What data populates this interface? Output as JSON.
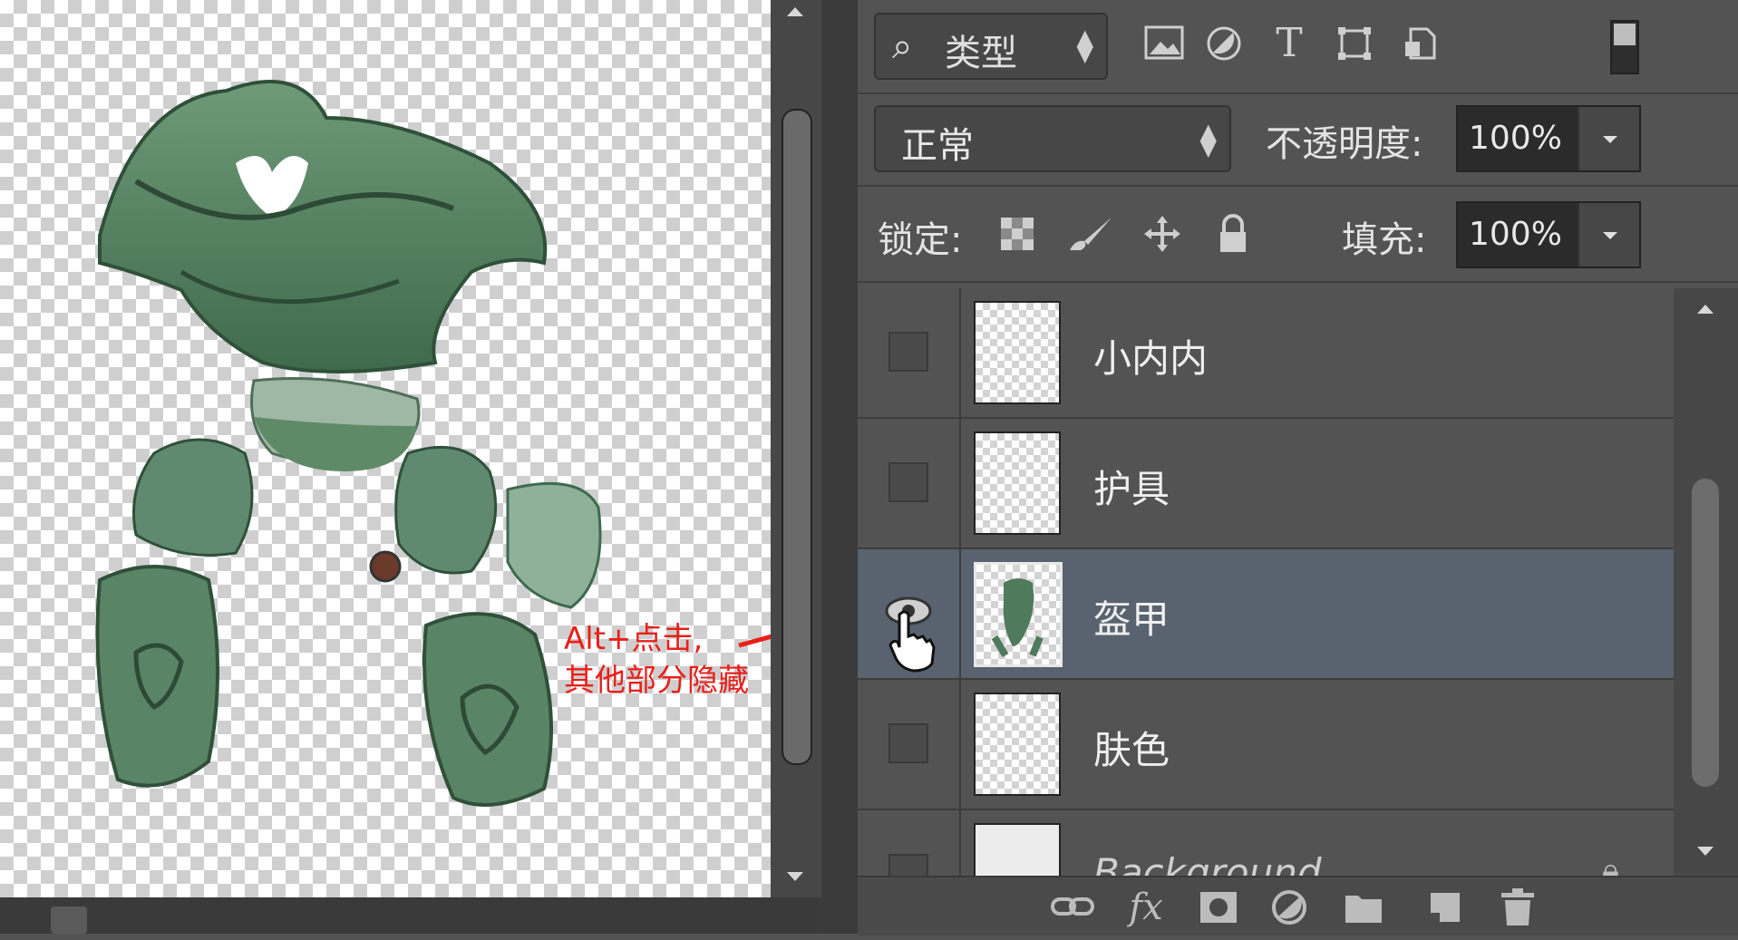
{
  "filter_bar": {
    "search_icon": "magnifier-icon",
    "filter_type_label": "类型",
    "icons": [
      "image-filter-icon",
      "adjustment-filter-icon",
      "text-filter-icon",
      "shape-filter-icon",
      "smart-object-filter-icon"
    ],
    "text_icon_glyph": "T"
  },
  "blend_row": {
    "blend_mode": "正常",
    "opacity_label": "不透明度:",
    "opacity_value": "100%"
  },
  "lock_row": {
    "lock_label": "锁定:",
    "fill_label": "填充:",
    "fill_value": "100%"
  },
  "layers": [
    {
      "name": "小内内",
      "visible": false,
      "selected": false
    },
    {
      "name": "护具",
      "visible": false,
      "selected": false
    },
    {
      "name": "盔甲",
      "visible": true,
      "selected": true
    },
    {
      "name": "肤色",
      "visible": false,
      "selected": false
    },
    {
      "name": "Background",
      "visible": false,
      "selected": false,
      "locked": true
    }
  ],
  "annotation": {
    "line1": "Alt+点击,",
    "line2": "其他部分隐藏",
    "color": "#e8201a"
  },
  "footer_icons": [
    "link-icon",
    "fx-icon",
    "mask-icon",
    "adjustment-icon",
    "folder-icon",
    "new-layer-icon",
    "trash-icon"
  ],
  "footer_fx_label": "fx",
  "colors": {
    "panel_bg": "#535353",
    "selected_layer": "#58636f",
    "armor_green": "#4f7a5c"
  }
}
